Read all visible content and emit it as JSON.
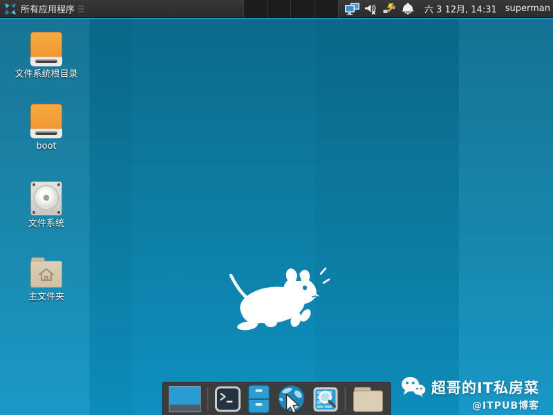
{
  "panel": {
    "menu": {
      "label": "所有应用程序",
      "icon": "xubuntu-logo-icon"
    },
    "pager_workspaces": 4,
    "tray": [
      {
        "icon": "display-icon"
      },
      {
        "icon": "volume-muted-icon"
      },
      {
        "icon": "network-icon"
      },
      {
        "icon": "notification-bell-icon"
      }
    ],
    "clock": "六 3 12月, 14:31",
    "username": "superman"
  },
  "desktop": {
    "icons": [
      {
        "label": "文件系统根目录",
        "icon": "orange-drive-icon"
      },
      {
        "label": "boot",
        "icon": "orange-drive-icon"
      },
      {
        "label": "文件系统",
        "icon": "harddisk-icon"
      },
      {
        "label": "主文件夹",
        "icon": "home-folder-icon"
      }
    ],
    "logo": "xfce-mouse-logo"
  },
  "dock": {
    "items": [
      {
        "name": "workspace-switcher",
        "icon": "workspace-thumbnail-icon"
      },
      {
        "name": "terminal",
        "icon": "terminal-icon"
      },
      {
        "name": "file-cabinet",
        "icon": "file-cabinet-icon"
      },
      {
        "name": "web-browser",
        "icon": "globe-cursor-icon"
      },
      {
        "name": "app-finder",
        "icon": "magnifier-keyboard-icon"
      },
      {
        "name": "file-manager",
        "icon": "folder-icon"
      }
    ]
  },
  "watermark": {
    "icon": "wechat-icon",
    "title": "超哥的IT私房菜",
    "subtitle": "@ITPUB博客"
  },
  "colors": {
    "wallpaper_blue": "#0d86b5",
    "panel_bg": "#323232",
    "dock_bg": "#3c3c3c",
    "drive_orange": "#f19a38",
    "pager_cell": "#1c1c1c"
  }
}
